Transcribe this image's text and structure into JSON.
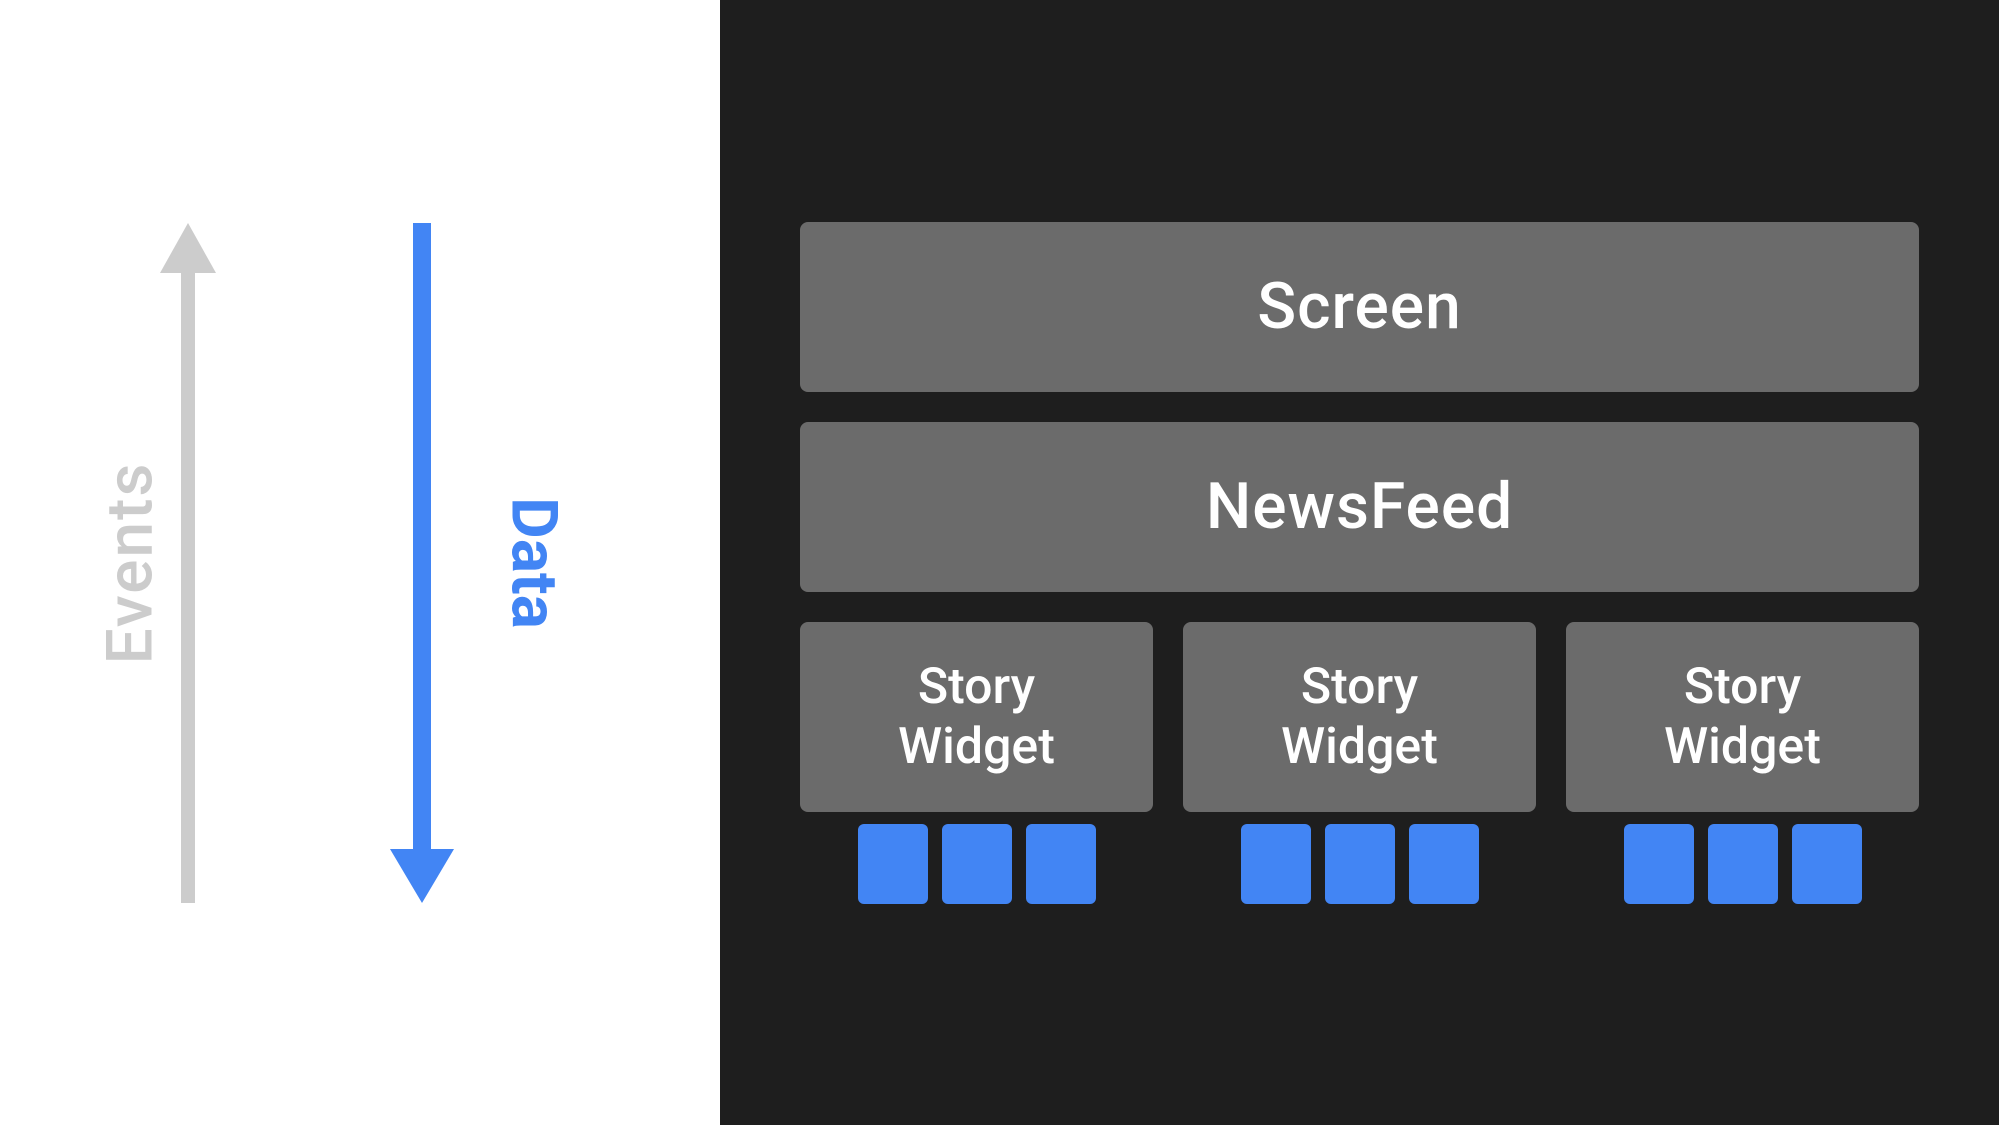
{
  "left_panel": {
    "background": "#ffffff",
    "events_label": "Events",
    "data_label": "Data",
    "events_color": "#cccccc",
    "data_color": "#4285f4"
  },
  "right_panel": {
    "background": "#1e1e1e",
    "screen_label": "Screen",
    "newsfeed_label": "NewsFeed",
    "story_widgets": [
      {
        "label": "Story\nWidget"
      },
      {
        "label": "Story\nWidget"
      },
      {
        "label": "Story\nWidget"
      }
    ],
    "blue_items_per_widget": 3
  }
}
